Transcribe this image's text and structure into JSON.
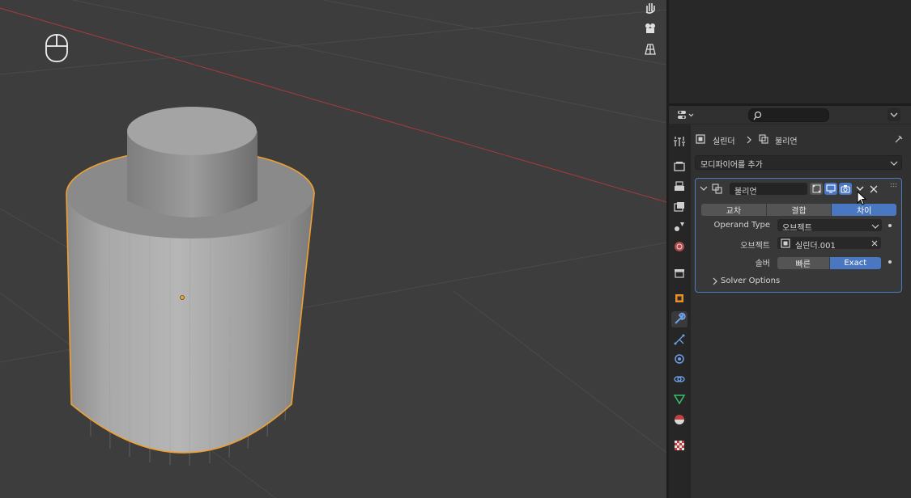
{
  "properties": {
    "breadcrumb": {
      "object_name": "실린더",
      "modifier_name": "불리언"
    },
    "add_modifier_label": "모디파이어를 추가",
    "modifier": {
      "name": "불리언",
      "operations": [
        "교차",
        "결합",
        "차이"
      ],
      "selected_operation": "차이",
      "operand_type_label": "Operand Type",
      "operand_type_value": "오브젝트",
      "object_label": "오브젝트",
      "object_value": "실린더.001",
      "solver_label": "솔버",
      "solver_options": [
        "빠른",
        "Exact"
      ],
      "selected_solver": "Exact",
      "solver_options_label": "Solver Options"
    },
    "tabs": [
      {
        "icon": "tool-icon",
        "active": false
      },
      {
        "icon": "render-icon",
        "active": false
      },
      {
        "icon": "output-icon",
        "active": false
      },
      {
        "icon": "view-layer-icon",
        "active": false
      },
      {
        "icon": "scene-icon",
        "active": false
      },
      {
        "icon": "world-icon",
        "active": false
      },
      {
        "icon": "collection-icon",
        "active": false
      },
      {
        "icon": "object-icon",
        "active": false
      },
      {
        "icon": "modifier-wrench-icon",
        "active": true
      },
      {
        "icon": "particles-icon",
        "active": false
      },
      {
        "icon": "physics-icon",
        "active": false
      },
      {
        "icon": "constraints-icon",
        "active": false
      },
      {
        "icon": "object-data-icon",
        "active": false
      },
      {
        "icon": "material-icon",
        "active": false
      },
      {
        "icon": "texture-icon",
        "active": false
      }
    ]
  },
  "viewport": {
    "gizmos": [
      "hand-pan-icon",
      "camera-icon",
      "perspective-grid-icon"
    ],
    "mouse_icon": "mouse-icon",
    "selection_color": "#f0a030",
    "axis_color": "#a83a3a"
  },
  "colors": {
    "accent": "#4a77c2",
    "panel_border": "#4c7bc0"
  }
}
